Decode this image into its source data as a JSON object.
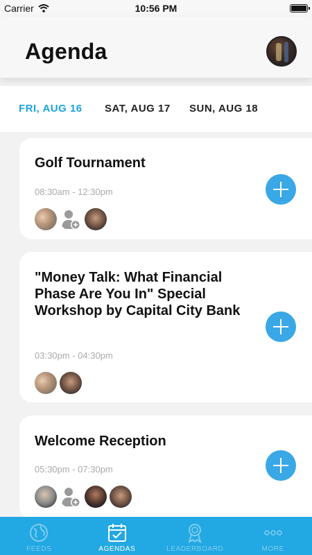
{
  "status_bar": {
    "carrier": "Carrier",
    "time": "10:56 PM"
  },
  "header": {
    "title": "Agenda"
  },
  "date_tabs": [
    {
      "label": "FRI, AUG 16",
      "active": true
    },
    {
      "label": "SAT, AUG 17",
      "active": false
    },
    {
      "label": "SUN, AUG 18",
      "active": false
    }
  ],
  "events": [
    {
      "title": "Golf Tournament",
      "time": "08:30am - 12:30pm"
    },
    {
      "title": "\"Money Talk: What Financial Phase Are You In\" Special Workshop by Capital City Bank",
      "time": "03:30pm - 04:30pm"
    },
    {
      "title": "Welcome Reception",
      "time": "05:30pm - 07:30pm"
    }
  ],
  "tabs": [
    {
      "label": "FEEDS",
      "icon": "globe-icon",
      "active": false
    },
    {
      "label": "AGENDAS",
      "icon": "calendar-check-icon",
      "active": true
    },
    {
      "label": "LEADERBOARD",
      "icon": "award-icon",
      "active": false
    },
    {
      "label": "MORE",
      "icon": "more-dots-icon",
      "active": false
    }
  ],
  "colors": {
    "accent": "#1aa3df",
    "tab_bar": "#22a8e2",
    "add_button": "#3aa8e6",
    "time_text": "#aaaaaa"
  }
}
